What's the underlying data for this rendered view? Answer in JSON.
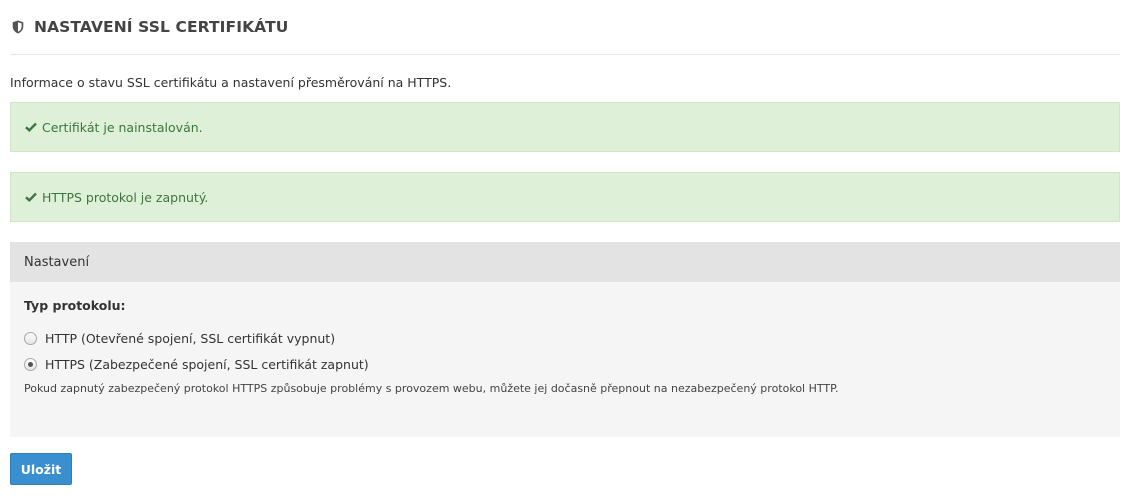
{
  "header": {
    "title": "NASTAVENÍ SSL CERTIFIKÁTU",
    "icon": "shield-icon"
  },
  "intro": "Informace o stavu SSL certifikátu a nastavení přesměrování na HTTPS.",
  "alerts": [
    {
      "icon": "check-icon",
      "text": "Certifikát je nainstalován."
    },
    {
      "icon": "check-icon",
      "text": "HTTPS protokol je zapnutý."
    }
  ],
  "settings": {
    "heading": "Nastavení",
    "protocol_label": "Typ protokolu:",
    "options": [
      {
        "label": "HTTP (Otevřené spojení, SSL certifikát vypnut)",
        "checked": false
      },
      {
        "label": "HTTPS (Zabezpečené spojení, SSL certifikát zapnut)",
        "checked": true
      }
    ],
    "help": "Pokud zapnutý zabezpečený protokol HTTPS způsobuje problémy s provozem webu, můžete jej dočasně přepnout na nezabezpečený protokol HTTP."
  },
  "save_label": "Uložit",
  "colors": {
    "success_bg": "#dff0d8",
    "success_text": "#3c763d",
    "button_bg": "#3a8fd1"
  }
}
